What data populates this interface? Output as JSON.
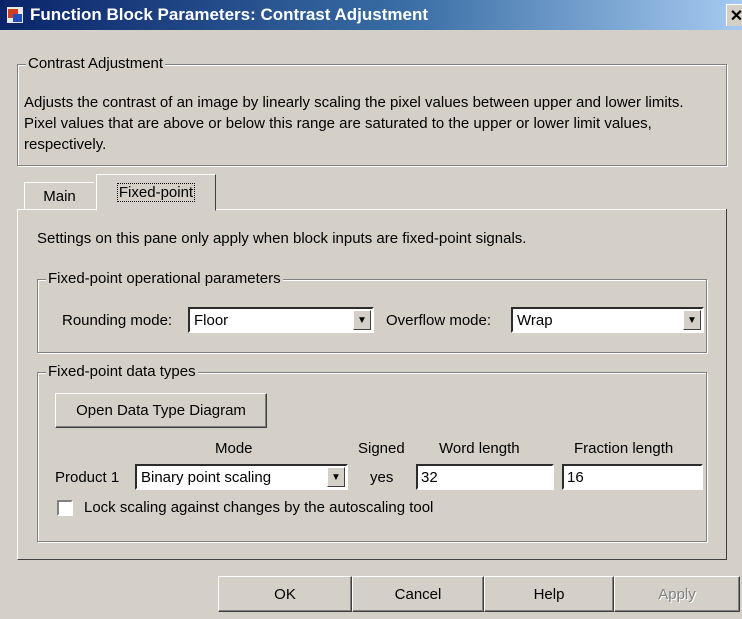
{
  "window": {
    "title": "Function Block Parameters: Contrast Adjustment",
    "close_glyph": "✕",
    "icon": "simulink-block-icon"
  },
  "block_group": {
    "legend": "Contrast Adjustment",
    "description": "Adjusts the contrast of an image by linearly scaling the pixel values between upper and lower limits. Pixel values that are above or below this range are saturated to the upper or lower limit values, respectively."
  },
  "tabs": [
    {
      "label": "Main",
      "active": false
    },
    {
      "label": "Fixed-point",
      "active": true
    }
  ],
  "pane": {
    "note": "Settings on this pane only apply when block inputs are fixed-point signals."
  },
  "operational": {
    "legend": "Fixed-point operational parameters",
    "rounding_label": "Rounding mode:",
    "rounding_value": "Floor",
    "overflow_label": "Overflow mode:",
    "overflow_value": "Wrap"
  },
  "datatypes": {
    "legend": "Fixed-point data types",
    "open_diagram_label": "Open Data Type Diagram",
    "headers": {
      "mode": "Mode",
      "signed": "Signed",
      "word_length": "Word length",
      "fraction_length": "Fraction length"
    },
    "product": {
      "label": "Product 1",
      "mode": "Binary point scaling",
      "signed": "yes",
      "word_length": "32",
      "fraction_length": "16"
    },
    "lock_scaling_label": "Lock scaling against changes by the autoscaling tool",
    "lock_scaling_checked": false
  },
  "buttons": {
    "ok": "OK",
    "cancel": "Cancel",
    "help": "Help",
    "apply": "Apply"
  },
  "colors": {
    "titlebar_start": "#0a246a",
    "titlebar_end": "#a6caf0",
    "face": "#d4d0c8"
  }
}
